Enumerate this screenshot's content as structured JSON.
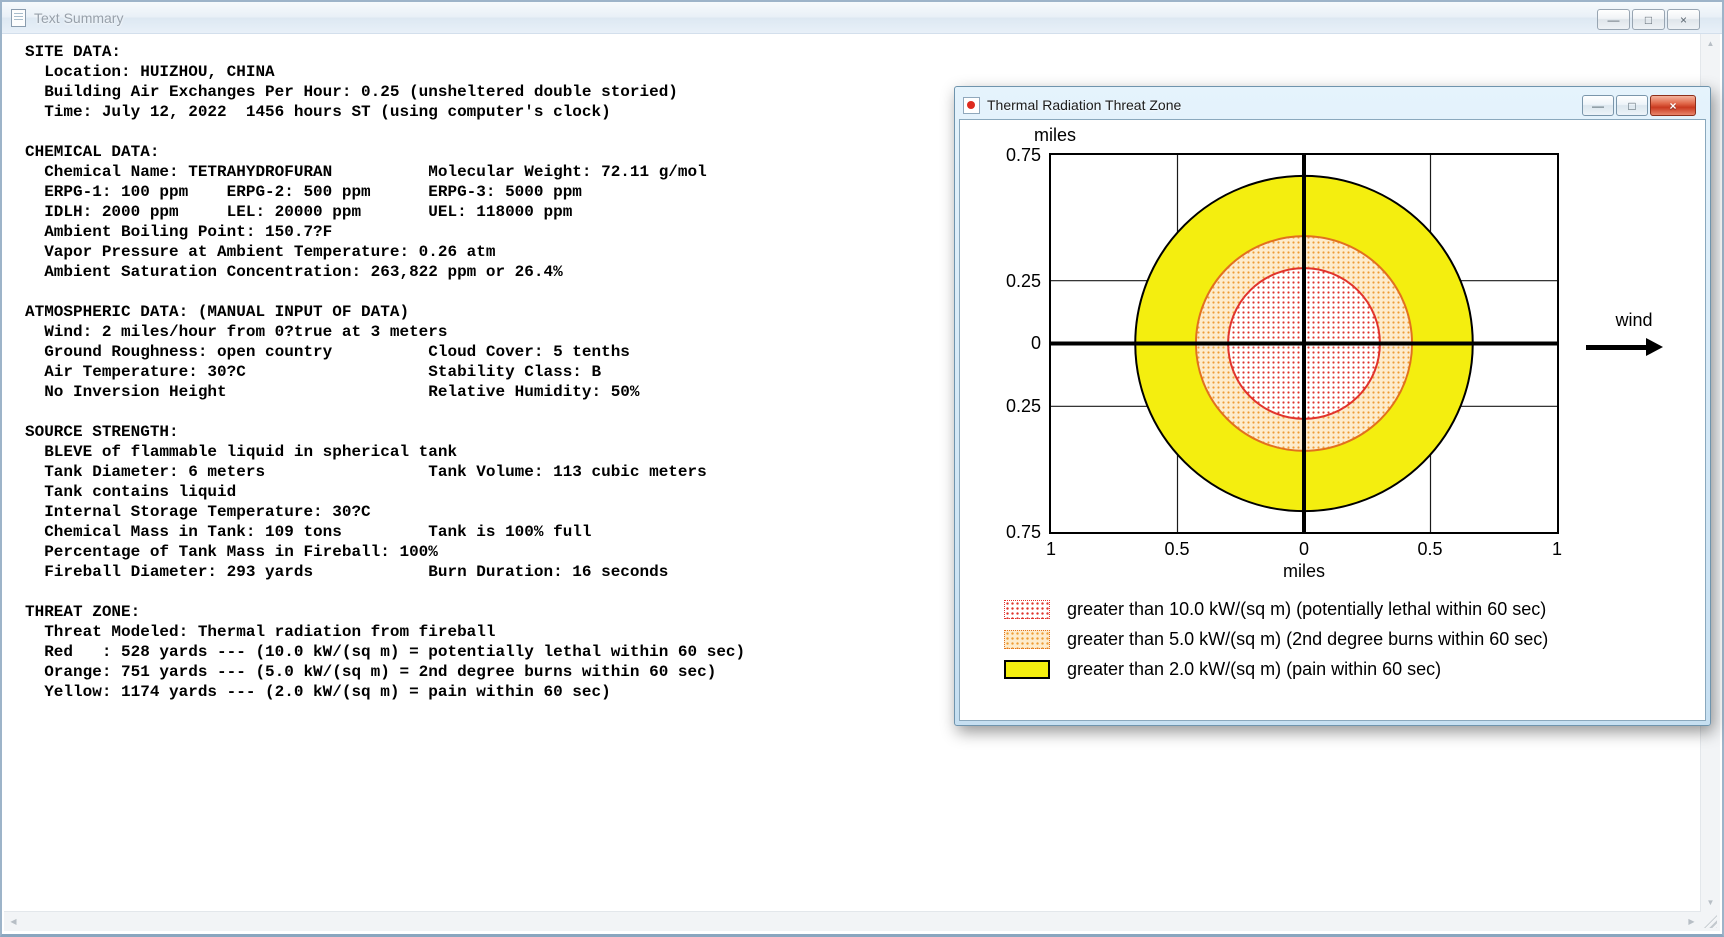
{
  "window": {
    "title": "Text Summary"
  },
  "icons": {
    "minimize": "—",
    "maximize": "□",
    "close": "×",
    "scroll_up": "▲",
    "scroll_down": "▼",
    "scroll_left": "◀",
    "scroll_right": "▶"
  },
  "summary": {
    "lines": [
      "SITE DATA:",
      "  Location: HUIZHOU, CHINA",
      "  Building Air Exchanges Per Hour: 0.25 (unsheltered double storied)",
      "  Time: July 12, 2022  1456 hours ST (using computer's clock)",
      "",
      "CHEMICAL DATA:",
      "  Chemical Name: TETRAHYDROFURAN          Molecular Weight: 72.11 g/mol",
      "  ERPG-1: 100 ppm    ERPG-2: 500 ppm      ERPG-3: 5000 ppm",
      "  IDLH: 2000 ppm     LEL: 20000 ppm       UEL: 118000 ppm",
      "  Ambient Boiling Point: 150.7?F",
      "  Vapor Pressure at Ambient Temperature: 0.26 atm",
      "  Ambient Saturation Concentration: 263,822 ppm or 26.4%",
      "",
      "ATMOSPHERIC DATA: (MANUAL INPUT OF DATA)",
      "  Wind: 2 miles/hour from 0?true at 3 meters",
      "  Ground Roughness: open country          Cloud Cover: 5 tenths",
      "  Air Temperature: 30?C                   Stability Class: B",
      "  No Inversion Height                     Relative Humidity: 50%",
      "",
      "SOURCE STRENGTH:",
      "  BLEVE of flammable liquid in spherical tank",
      "  Tank Diameter: 6 meters                 Tank Volume: 113 cubic meters",
      "  Tank contains liquid",
      "  Internal Storage Temperature: 30?C",
      "  Chemical Mass in Tank: 109 tons         Tank is 100% full",
      "  Percentage of Tank Mass in Fireball: 100%",
      "  Fireball Diameter: 293 yards            Burn Duration: 16 seconds",
      "",
      "THREAT ZONE:",
      "  Threat Modeled: Thermal radiation from fireball",
      "  Red   : 528 yards --- (10.0 kW/(sq m) = potentially lethal within 60 sec)",
      "  Orange: 751 yards --- (5.0 kW/(sq m) = 2nd degree burns within 60 sec)",
      "  Yellow: 1174 yards --- (2.0 kW/(sq m) = pain within 60 sec)"
    ]
  },
  "threat_window": {
    "title": "Thermal Radiation Threat Zone",
    "wind_label": "wind",
    "legend": [
      {
        "zone": "red",
        "label": "greater than 10.0 kW/(sq m) (potentially lethal within 60 sec)"
      },
      {
        "zone": "orange",
        "label": "greater than 5.0 kW/(sq m) (2nd degree burns within 60 sec)"
      },
      {
        "zone": "yellow",
        "label": "greater than 2.0 kW/(sq m) (pain within 60 sec)"
      }
    ]
  },
  "chart_data": {
    "type": "area",
    "subtype": "threat-zone-concentric-rings",
    "title": "Thermal Radiation Threat Zone",
    "x_axis": {
      "label": "miles",
      "range": [
        -1,
        1
      ],
      "ticks": [
        -1,
        -0.5,
        0,
        0.5,
        1
      ],
      "tick_labels": [
        "1",
        "0.5",
        "0",
        "0.5",
        "1"
      ]
    },
    "y_axis": {
      "label": "miles",
      "range": [
        -0.75,
        0.75
      ],
      "ticks": [
        0.75,
        0.25,
        0,
        -0.25,
        -0.75
      ],
      "tick_labels": [
        "0.75",
        "0.25",
        "0",
        "0.25",
        "0.75"
      ]
    },
    "gridlines": {
      "x": [
        -0.5,
        0.5
      ],
      "y": [
        -0.25,
        0.25
      ]
    },
    "grid_on": true,
    "center": [
      0,
      0
    ],
    "zones": [
      {
        "name": "red",
        "threshold_kw_sqm": 10.0,
        "radius_yards": 528,
        "radius_miles": 0.3,
        "effect": "potentially lethal within 60 sec",
        "fill": "dots",
        "color": "#e1342c",
        "outline": "#e1342c",
        "base": "#ffffff"
      },
      {
        "name": "orange",
        "threshold_kw_sqm": 5.0,
        "radius_yards": 751,
        "radius_miles": 0.427,
        "effect": "2nd degree burns within 60 sec",
        "fill": "dots",
        "color": "#ef9d35",
        "outline": "#e2711d",
        "base": "#fdeccd"
      },
      {
        "name": "yellow",
        "threshold_kw_sqm": 2.0,
        "radius_yards": 1174,
        "radius_miles": 0.667,
        "effect": "pain within 60 sec",
        "fill": "solid",
        "color": "#f4ee0f",
        "outline": "#000000",
        "base": "#f4ee0f"
      }
    ],
    "wind": {
      "label": "wind",
      "direction": "right"
    },
    "legend_position": "bottom-left"
  }
}
